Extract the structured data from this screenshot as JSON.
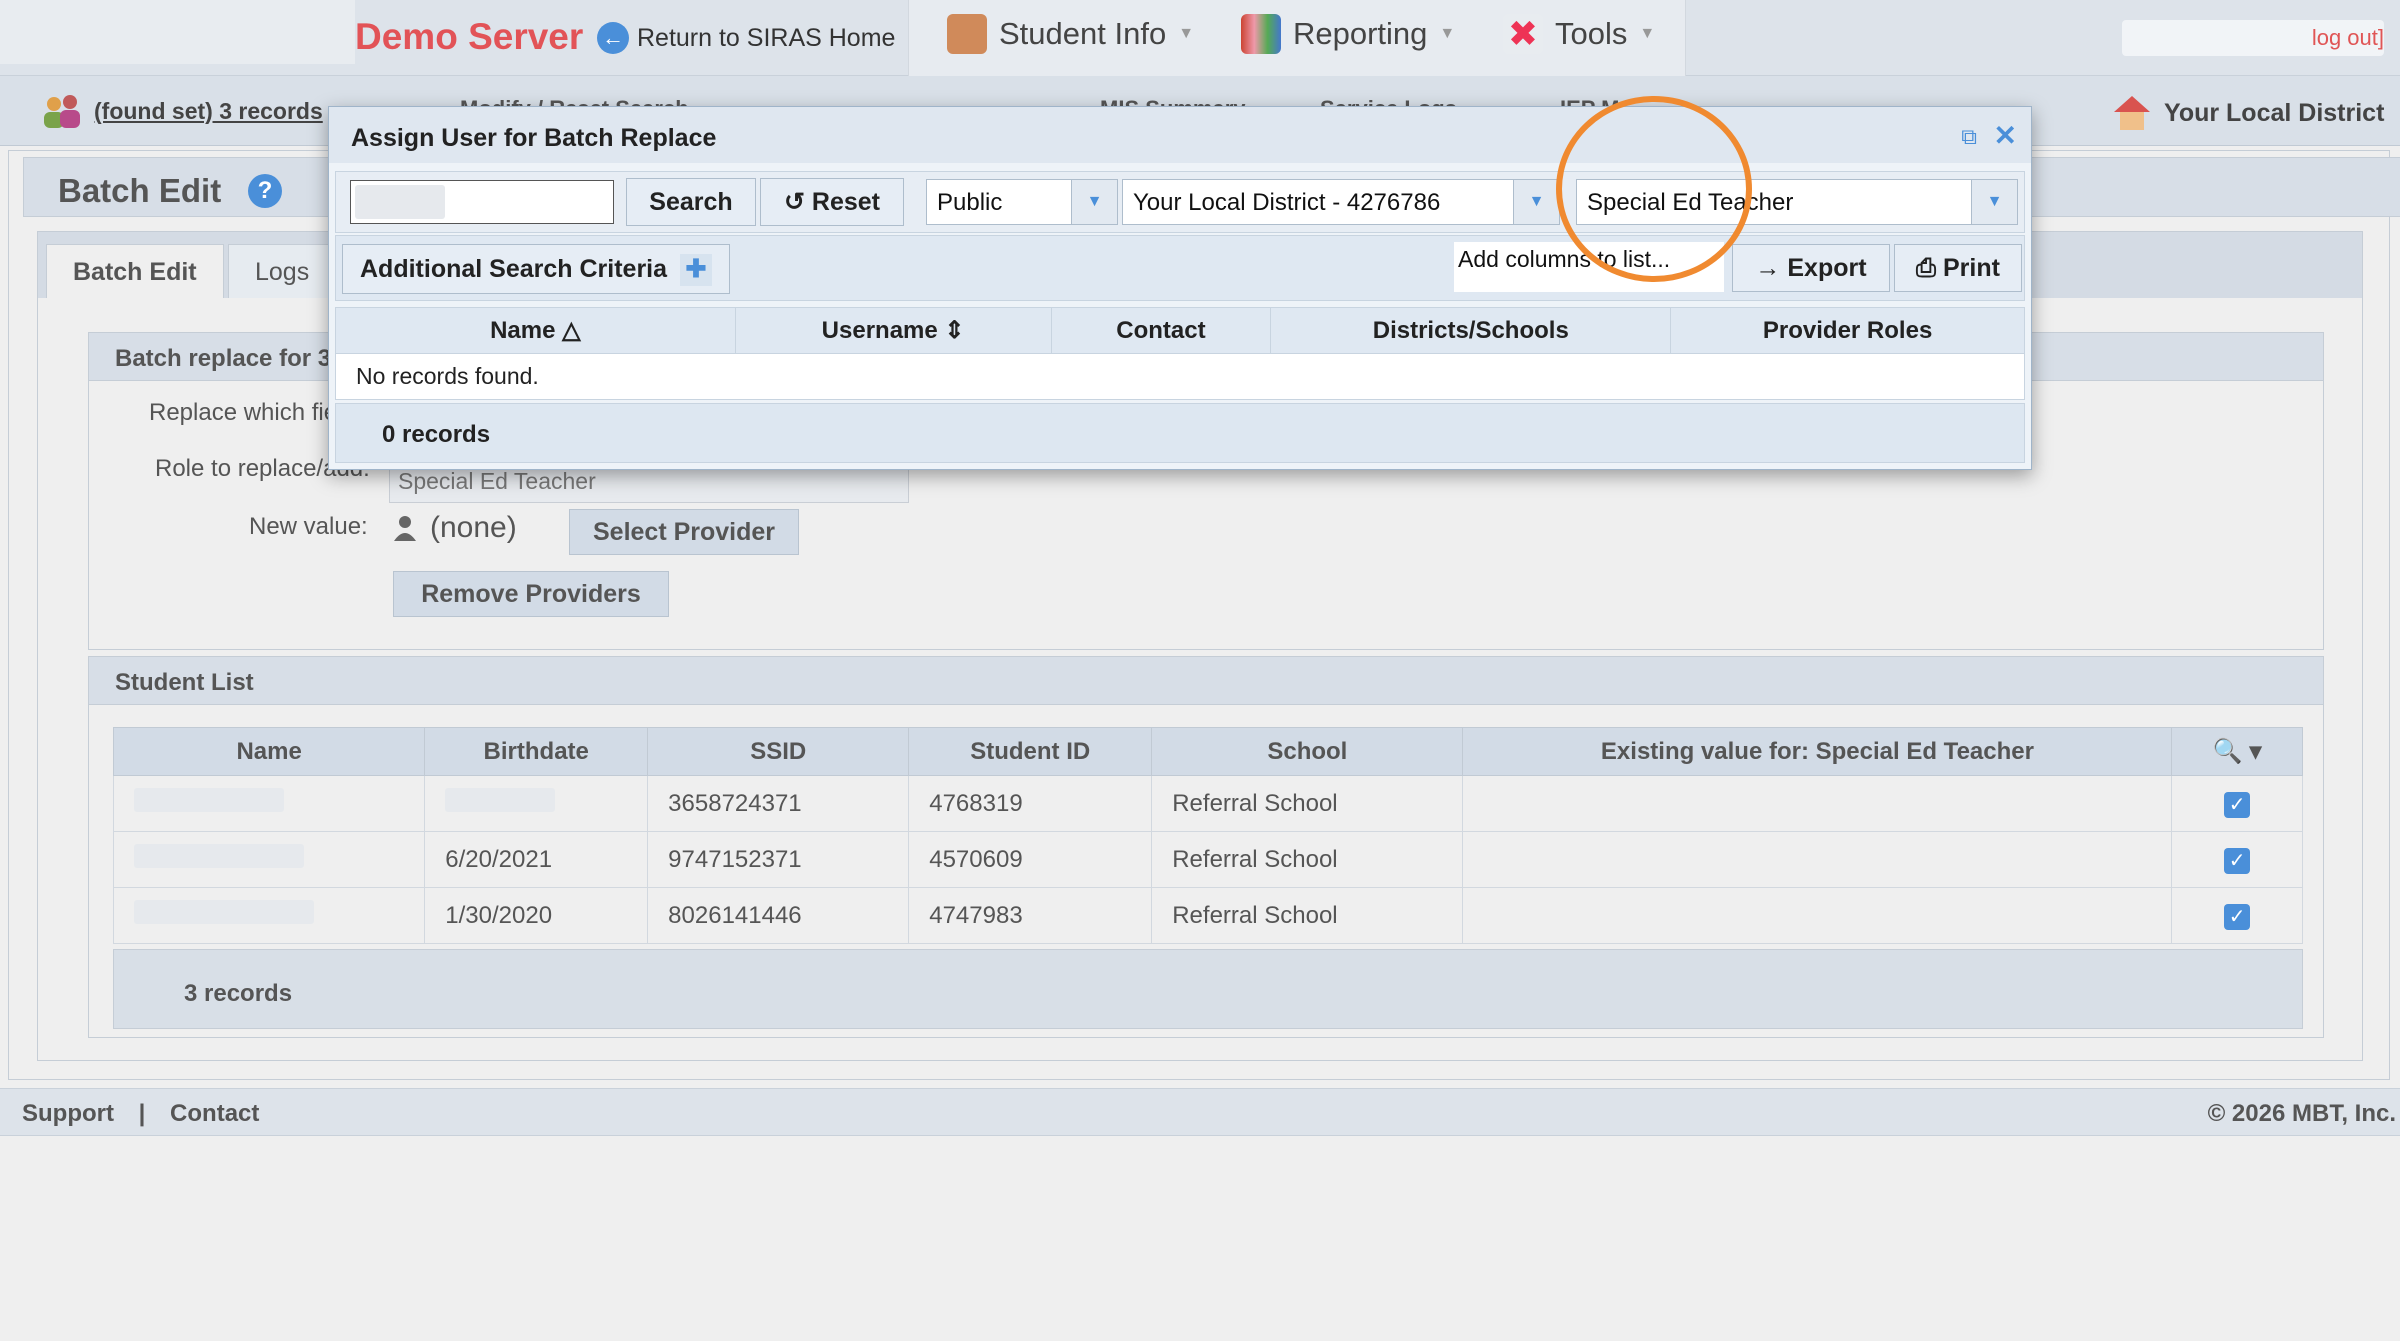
{
  "header": {
    "brand": "Demo Server",
    "return_link": "Return to SIRAS Home",
    "nav": [
      {
        "label": "Student Info",
        "icon": "student-icon"
      },
      {
        "label": "Reporting",
        "icon": "reporting-icon"
      },
      {
        "label": "Tools",
        "icon": "tools-icon"
      }
    ],
    "logout": "log out]"
  },
  "subbar": {
    "found_set": "(found set) 3 records",
    "modify": "Modify / Reset Search",
    "mis_summary": "MIS Summary",
    "service_logs": "Service Logs",
    "iep": "IEP M",
    "district": "Your Local District"
  },
  "page": {
    "title": "Batch Edit",
    "help": "?",
    "tabs": [
      "Batch Edit",
      "Logs"
    ]
  },
  "batch_section": {
    "title": "Batch replace for 3",
    "replace_label": "Replace which fie",
    "role_label": "Role to replace/add:",
    "role_value": "Special Ed Teacher",
    "new_value_label": "New value:",
    "new_value": "(none)",
    "select_provider": "Select Provider",
    "remove_providers": "Remove Providers"
  },
  "student_list": {
    "title": "Student List",
    "columns": [
      "Name",
      "Birthdate",
      "SSID",
      "Student ID",
      "School",
      "Existing value for: Special Ed Teacher"
    ],
    "rows": [
      {
        "birthdate": "",
        "ssid": "3658724371",
        "student_id": "4768319",
        "school": "Referral School",
        "existing": ""
      },
      {
        "birthdate": "6/20/2021",
        "ssid": "9747152371",
        "student_id": "4570609",
        "school": "Referral School",
        "existing": ""
      },
      {
        "birthdate": "1/30/2020",
        "ssid": "8026141446",
        "student_id": "4747983",
        "school": "Referral School",
        "existing": ""
      }
    ],
    "footer": "3 records"
  },
  "footer": {
    "support": "Support",
    "separator": "|",
    "contact": "Contact",
    "copyright": "© 2026 MBT, Inc."
  },
  "modal": {
    "title": "Assign User for Batch Replace",
    "search_btn": "Search",
    "reset_btn": "Reset",
    "visibility": "Public",
    "district": "Your Local District - 4276786",
    "role": "Special Ed Teacher",
    "additional_criteria": "Additional Search Criteria",
    "add_columns": "Add columns to list...",
    "export_btn": "Export",
    "print_btn": "Print",
    "columns": [
      "Name",
      "Username",
      "Contact",
      "Districts/Schools",
      "Provider Roles"
    ],
    "empty_message": "No records found.",
    "records": "0 records"
  },
  "colors": {
    "brand_red": "#e25357",
    "accent_blue": "#4a8fd9",
    "highlight_orange": "#f08a30"
  }
}
